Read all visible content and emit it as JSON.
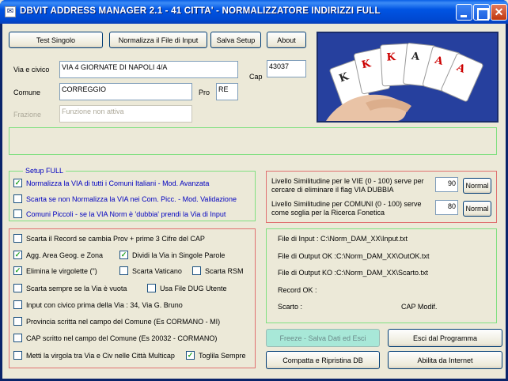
{
  "window": {
    "title": "DBVIT ADDRESS MANAGER 2.1 - 41 CITTA' - NORMALIZZATORE INDIRIZZI FULL",
    "app_icon": "envelope-icon"
  },
  "toolbar": {
    "test": "Test Singolo",
    "normalize": "Normalizza il File di Input",
    "save_setup": "Salva Setup",
    "about": "About"
  },
  "form": {
    "via_label": "Via e civico",
    "via_value": "VIA 4 GIORNATE DI NAPOLI 4/A",
    "cap_label": "Cap",
    "cap_value": "43037",
    "comune_label": "Comune",
    "comune_value": "CORREGGIO",
    "pro_label": "Pro",
    "pro_value": "RE",
    "frazione_label": "Frazione",
    "frazione_value": "Funzione non attiva"
  },
  "setup_full": {
    "title": "Setup FULL",
    "items": [
      {
        "label": "Normalizza la VIA di tutti i Comuni Italiani - Mod. Avanzata",
        "checked": true
      },
      {
        "label": "Scarta se non Normalizza la VIA nei Com. Picc. - Mod. Validazione",
        "checked": false
      },
      {
        "label": "Comuni Piccoli - se la VIA Norm è 'dubbia' prendi la Via di Input",
        "checked": false
      }
    ]
  },
  "options": {
    "scarta_record": "Scarta il Record se cambia Prov + prime 3 Cifre del CAP",
    "agg_area": "Agg. Area Geog. e Zona",
    "dividi_via": "Dividi la Via in Singole Parole",
    "elimina_virgolette": "Elimina le virgolette (\")",
    "scarta_vaticano": "Scarta Vaticano",
    "scarta_rsm": "Scarta RSM",
    "scarta_via_vuota": "Scarta sempre se la Via è vuota",
    "usa_dug": "Usa File DUG Utente",
    "input_civico": "Input con civico prima della Via : 34, Via G. Bruno",
    "provincia_comune": "Provincia scritta nel campo del Comune (Es CORMANO - MI)",
    "cap_comune": "CAP scritto nel campo del Comune (Es 20032 - CORMANO)",
    "metti_virgola": "Metti la virgola tra Via e Civ nelle Città Multicap",
    "toglila": "Toglila Sempre"
  },
  "similarity": {
    "vie_label": "Livello Similitudine per le VIE (0 - 100) serve per cercare di eliminare il flag VIA DUBBIA",
    "vie_value": "90",
    "comuni_label": "Livello Similitudine per COMUNI (0 - 100) serve come soglia per la Ricerca Fonetica",
    "comuni_value": "80",
    "normal": "Normal"
  },
  "files": {
    "input": "File di Input : C:\\Norm_DAM_XX\\Input.txt",
    "output_ok": "File di Output OK :C:\\Norm_DAM_XX\\OutOK.txt",
    "output_ko": "File di Output KO :C:\\Norm_DAM_XX\\Scarto.txt",
    "record_ok": "Record OK :",
    "scarto": "Scarto :",
    "cap_modif": "CAP Modif."
  },
  "actions": {
    "freeze": "Freeze - Salva Dati ed Esci",
    "exit": "Esci dal Programma",
    "compact": "Compatta e Ripristina DB",
    "enable_internet": "Abilita da Internet"
  }
}
